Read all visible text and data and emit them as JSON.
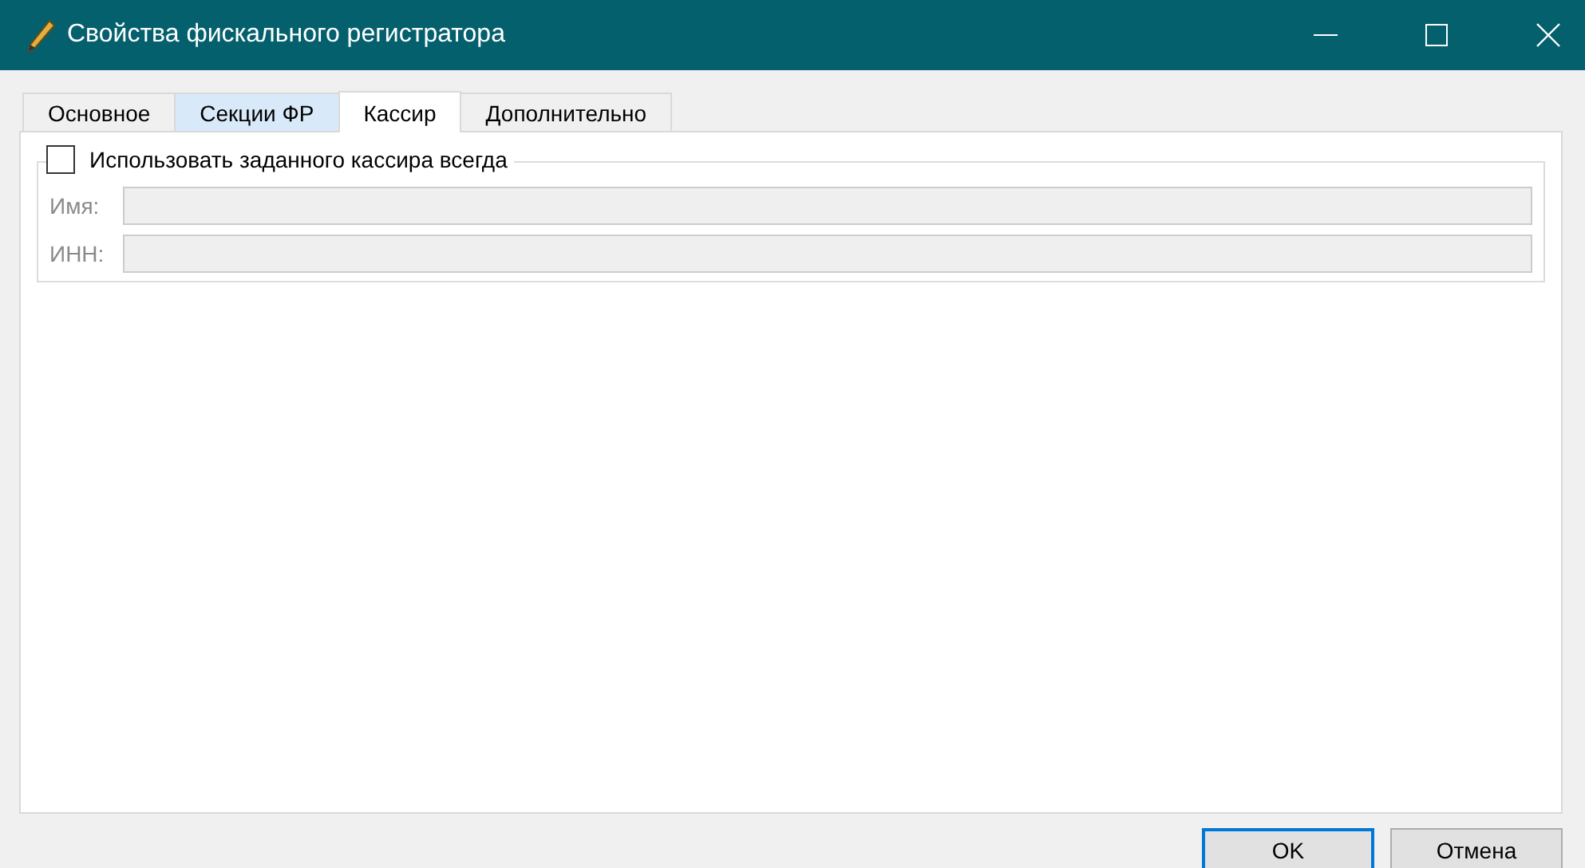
{
  "window": {
    "title": "Свойства фискального регистратора"
  },
  "tabs": [
    {
      "label": "Основное",
      "selected": false,
      "hovered": false
    },
    {
      "label": "Секции ФР",
      "selected": false,
      "hovered": true
    },
    {
      "label": "Кассир",
      "selected": true,
      "hovered": false
    },
    {
      "label": "Дополнительно",
      "selected": false,
      "hovered": false
    }
  ],
  "group": {
    "checkbox": {
      "label": "Использовать заданного кассира всегда",
      "checked": false
    },
    "fields": [
      {
        "label": "Имя:",
        "disabled": true
      },
      {
        "label": "ИНН:",
        "disabled": true
      }
    ]
  },
  "buttons": [
    {
      "label": "OK",
      "default": true
    },
    {
      "label": "Отмена",
      "default": false
    }
  ]
}
